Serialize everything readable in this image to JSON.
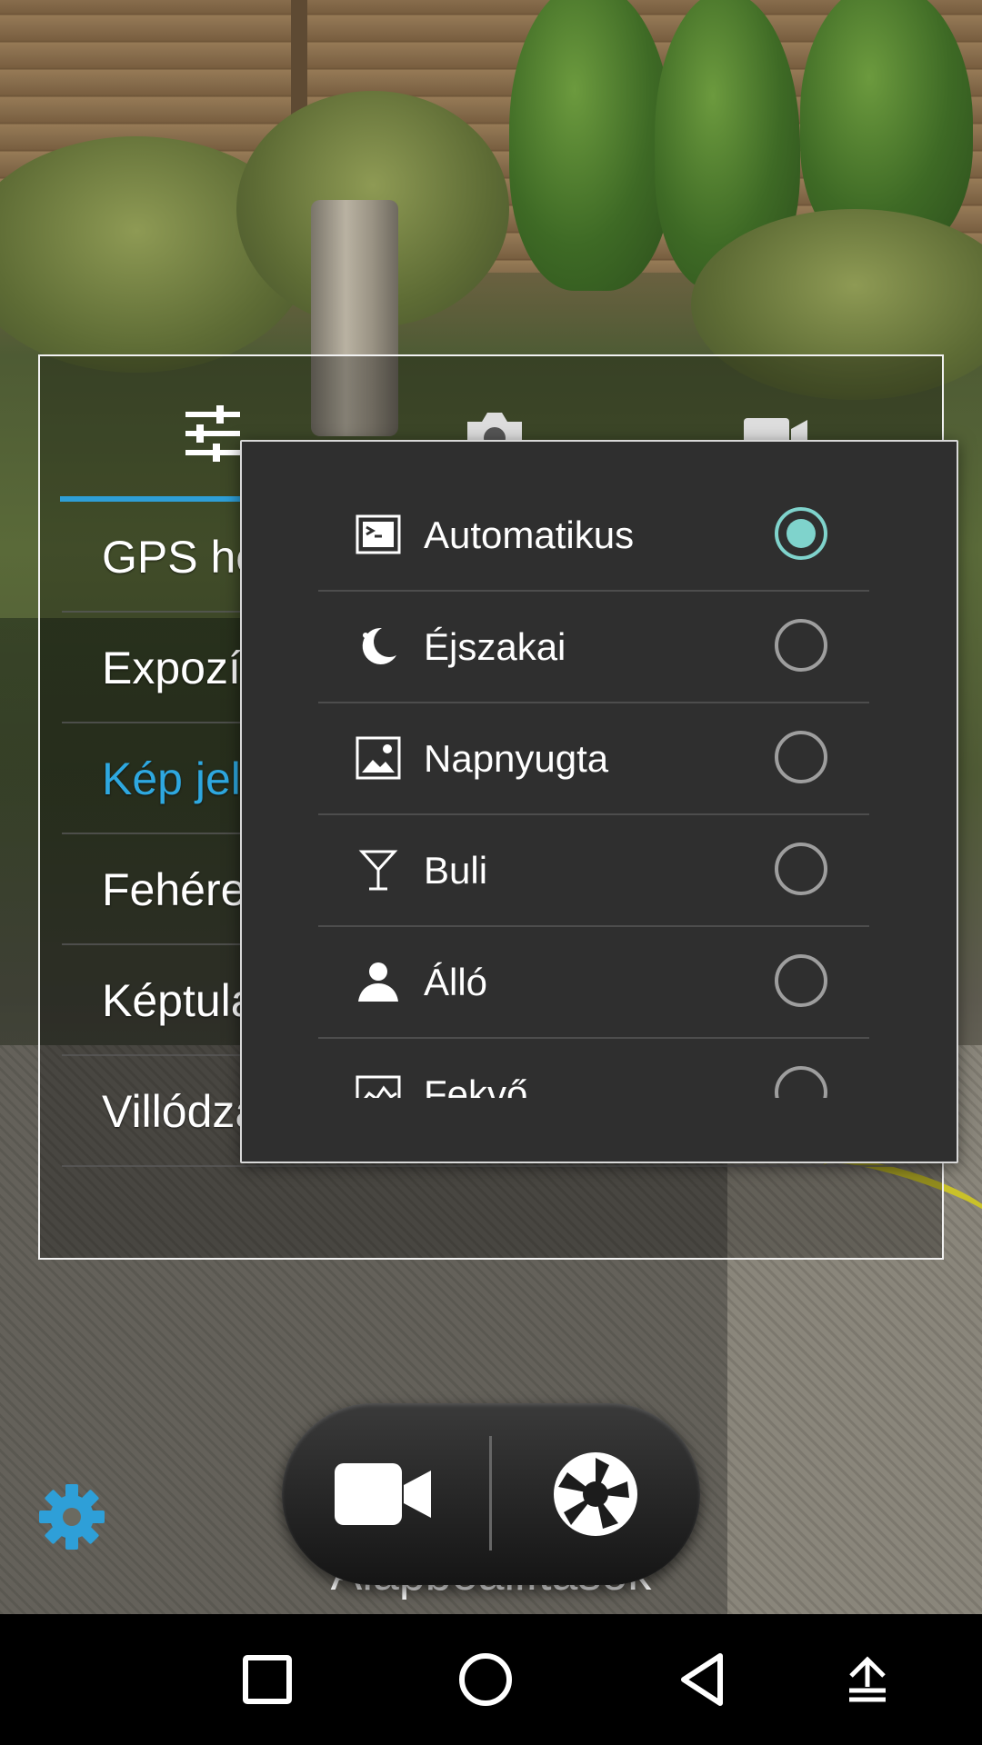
{
  "settings": {
    "tabs": [
      {
        "icon": "sliders-icon"
      },
      {
        "icon": "camera-icon"
      },
      {
        "icon": "video-camera-icon"
      }
    ],
    "items": [
      {
        "label": "GPS he"
      },
      {
        "label": "Expozíc"
      },
      {
        "label": "Kép jell",
        "active": true
      },
      {
        "label": "Fehéreg"
      },
      {
        "label": "Képtula"
      },
      {
        "label": "Villódza"
      }
    ],
    "defaults_label": "Alapbeállítások"
  },
  "scene_popup": {
    "options": [
      {
        "label": "Automatikus",
        "icon": "auto-scene-icon",
        "selected": true
      },
      {
        "label": "Éjszakai",
        "icon": "night-moon-icon",
        "selected": false
      },
      {
        "label": "Napnyugta",
        "icon": "sunset-landscape-icon",
        "selected": false
      },
      {
        "label": "Buli",
        "icon": "party-cocktail-icon",
        "selected": false
      },
      {
        "label": "Álló",
        "icon": "portrait-person-icon",
        "selected": false
      },
      {
        "label": "Fekvő",
        "icon": "landscape-chart-icon",
        "selected": false
      }
    ]
  },
  "controls": {
    "video_button_icon": "video-camera-icon",
    "shutter_button_icon": "shutter-aperture-icon",
    "settings_button_icon": "gear-icon"
  },
  "navbar": {
    "buttons": [
      "recents-square-icon",
      "home-circle-icon",
      "back-triangle-icon",
      "upload-arrow-icon"
    ]
  },
  "colors": {
    "accent": "#2ea8e0",
    "radio_selected": "#7fd3cc",
    "popup_bg": "#2f2f2f",
    "gear": "#2e9fd8"
  }
}
